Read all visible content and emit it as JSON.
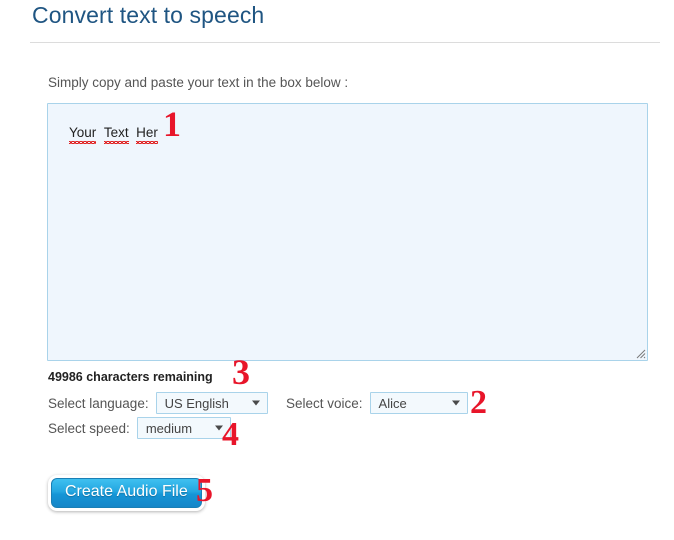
{
  "header": {
    "title": "Convert text to speech"
  },
  "main": {
    "instruction": "Simply copy and paste your text in the box below :",
    "textarea": {
      "value": "Your Text Her",
      "words": [
        "Your",
        "Text",
        "Her"
      ],
      "placeholder": "",
      "resize_handle_icon": "resize-grip-icon"
    },
    "char_count": "49986 characters remaining"
  },
  "controls": {
    "language": {
      "label": "Select language:",
      "value": "US English",
      "options": [
        "US English"
      ],
      "arrow_icon": "chevron-down-icon"
    },
    "voice": {
      "label": "Select voice:",
      "value": "Alice",
      "options": [
        "Alice"
      ],
      "arrow_icon": "chevron-down-icon"
    },
    "speed": {
      "label": "Select speed:",
      "value": "medium",
      "options": [
        "medium"
      ],
      "arrow_icon": "chevron-down-icon"
    }
  },
  "actions": {
    "create_audio_label": "Create Audio File"
  },
  "annotations": [
    {
      "id": "step-1",
      "text": "1"
    },
    {
      "id": "step-2",
      "text": "2"
    },
    {
      "id": "step-3",
      "text": "3"
    },
    {
      "id": "step-4",
      "text": "4"
    },
    {
      "id": "step-5",
      "text": "5"
    }
  ],
  "colors": {
    "title": "#1f5582",
    "annotation_red": "#e8152a",
    "field_border": "#a9d3ea",
    "field_background": "#eff6fd",
    "button_blue": "#23a6e0"
  }
}
